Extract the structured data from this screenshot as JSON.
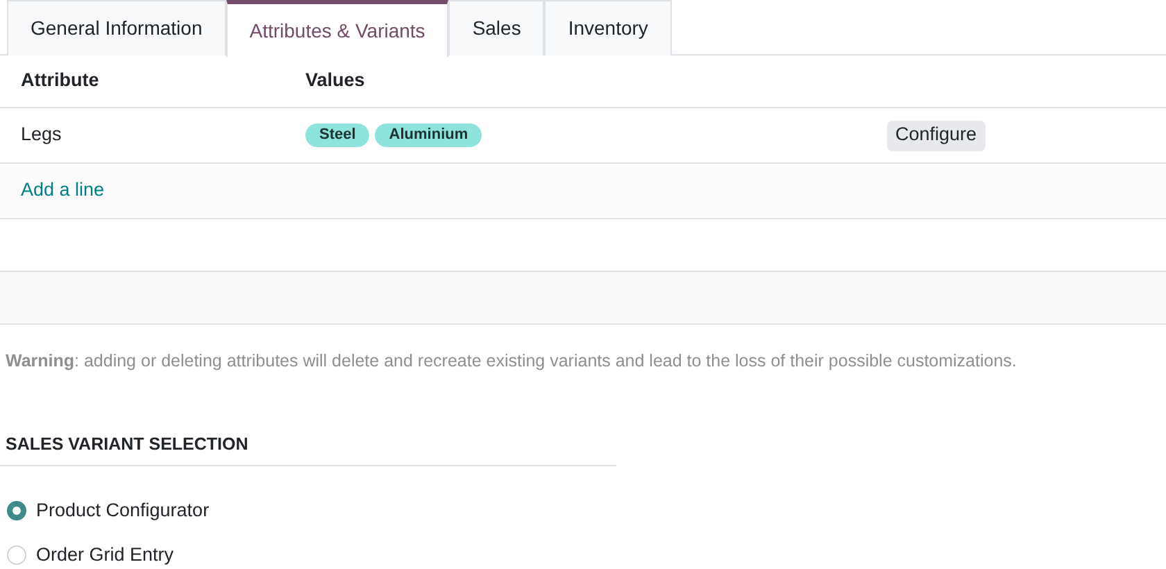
{
  "tabs": [
    {
      "label": "General Information",
      "selected": false
    },
    {
      "label": "Attributes & Variants",
      "selected": true
    },
    {
      "label": "Sales",
      "selected": false
    },
    {
      "label": "Inventory",
      "selected": false
    }
  ],
  "table": {
    "columns": [
      "Attribute",
      "Values"
    ],
    "rows": [
      {
        "attribute": "Legs",
        "values": [
          "Steel",
          "Aluminium"
        ],
        "action": "Configure"
      }
    ],
    "add_line": "Add a line"
  },
  "warning": "**Warning**: adding or deleting attributes will delete and recreate existing variants and lead to the loss of their possible customizations.",
  "section": {
    "title": "SALES VARIANT SELECTION",
    "options": [
      {
        "label": "Product Configurator",
        "selected": true
      },
      {
        "label": "Order Grid Entry",
        "selected": false
      }
    ]
  }
}
